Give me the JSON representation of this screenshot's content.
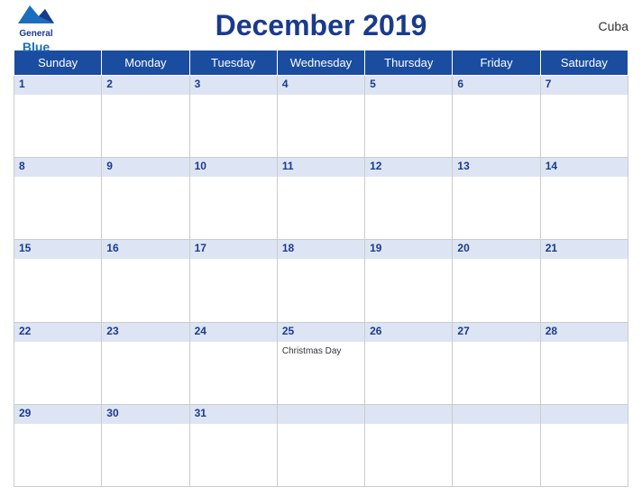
{
  "header": {
    "title": "December 2019",
    "country": "Cuba",
    "logo_general": "General",
    "logo_blue": "Blue"
  },
  "days": [
    "Sunday",
    "Monday",
    "Tuesday",
    "Wednesday",
    "Thursday",
    "Friday",
    "Saturday"
  ],
  "weeks": [
    {
      "dates": [
        1,
        2,
        3,
        4,
        5,
        6,
        7
      ],
      "events": {
        "4": ""
      }
    },
    {
      "dates": [
        8,
        9,
        10,
        11,
        12,
        13,
        14
      ],
      "events": {}
    },
    {
      "dates": [
        15,
        16,
        17,
        18,
        19,
        20,
        21
      ],
      "events": {}
    },
    {
      "dates": [
        22,
        23,
        24,
        25,
        26,
        27,
        28
      ],
      "events": {
        "25": "Christmas Day"
      }
    },
    {
      "dates": [
        29,
        30,
        31,
        null,
        null,
        null,
        null
      ],
      "events": {}
    }
  ]
}
